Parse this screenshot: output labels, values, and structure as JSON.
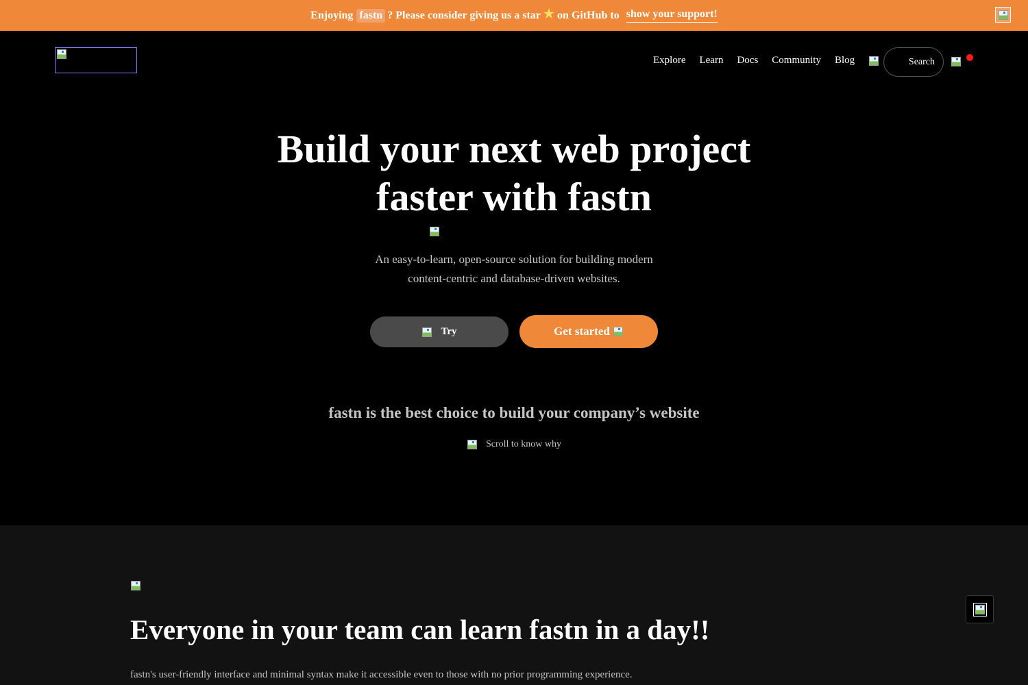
{
  "banner": {
    "prefix": "Enjoying",
    "brand": "fastn",
    "middle": "? Please consider giving us a star",
    "star_glyph": "★",
    "suffix": "on GitHub to",
    "link": "show your support!",
    "background_color": "#ef8839"
  },
  "nav": {
    "items": [
      {
        "label": "Explore"
      },
      {
        "label": "Learn"
      },
      {
        "label": "Docs"
      },
      {
        "label": "Community"
      },
      {
        "label": "Blog"
      }
    ],
    "search_label": "Search"
  },
  "hero": {
    "title_line1": "Build your next web project",
    "title_line2": "faster with fastn",
    "subtitle_line1": "An easy-to-learn, open-source solution for building modern",
    "subtitle_line2": "content-centric and database-driven websites.",
    "try_label": "Try",
    "get_started_label": "Get started",
    "best_choice": "fastn is the best choice to build your company’s website",
    "scroll_hint": "Scroll to know why"
  },
  "section2": {
    "title": "Everyone in your team can learn fastn in a day!!",
    "description": "fastn's user-friendly interface and minimal syntax make it accessible even to those with no prior programming experience."
  },
  "colors": {
    "accent": "#ef8839",
    "background": "#000000",
    "section_background": "#121212",
    "notification": "#ff1a1a"
  }
}
